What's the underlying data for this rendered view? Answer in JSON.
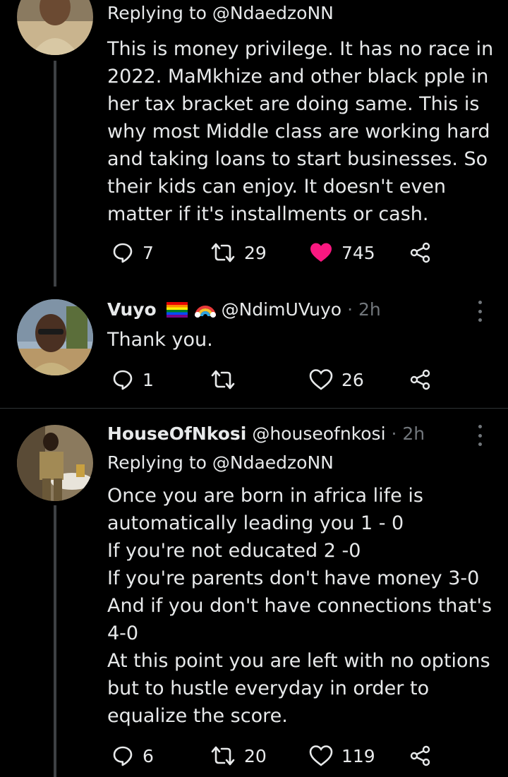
{
  "tweets": [
    {
      "reply_to": "Replying to @NdaedzoNN",
      "lines": [
        "This is money privilege. It has no race in",
        "2022. MaMkhize and other black pple in",
        "her tax bracket are doing same. This is",
        "why most Middle class are working hard",
        "and taking loans to start businesses. So",
        "their kids can enjoy. It doesn't even",
        "matter if it's installments or cash."
      ],
      "replies": "7",
      "retweets": "29",
      "likes": "745",
      "liked": true
    },
    {
      "name": "Vuyo",
      "handle": "@NdimUVuyo",
      "time": "· 2h",
      "lines": [
        "Thank you."
      ],
      "replies": "1",
      "retweets": "",
      "likes": "26",
      "liked": false
    },
    {
      "name": "HouseOfNkosi",
      "handle": "@houseofnkosi",
      "time": "· 2h",
      "reply_to": "Replying to @NdaedzoNN",
      "lines": [
        "Once you are born in africa life is",
        "automatically leading you 1 - 0",
        "If you're not educated 2 -0",
        "If you're parents don't have money  3-0",
        "And if you don't have connections that's",
        "4-0",
        "At this point you are left with no options",
        "but to hustle everyday in order to",
        "equalize the score."
      ],
      "replies": "6",
      "retweets": "20",
      "likes": "119",
      "liked": false
    }
  ],
  "colors": {
    "like_active": "#f91880",
    "muted": "#71767b",
    "background": "#000000"
  }
}
